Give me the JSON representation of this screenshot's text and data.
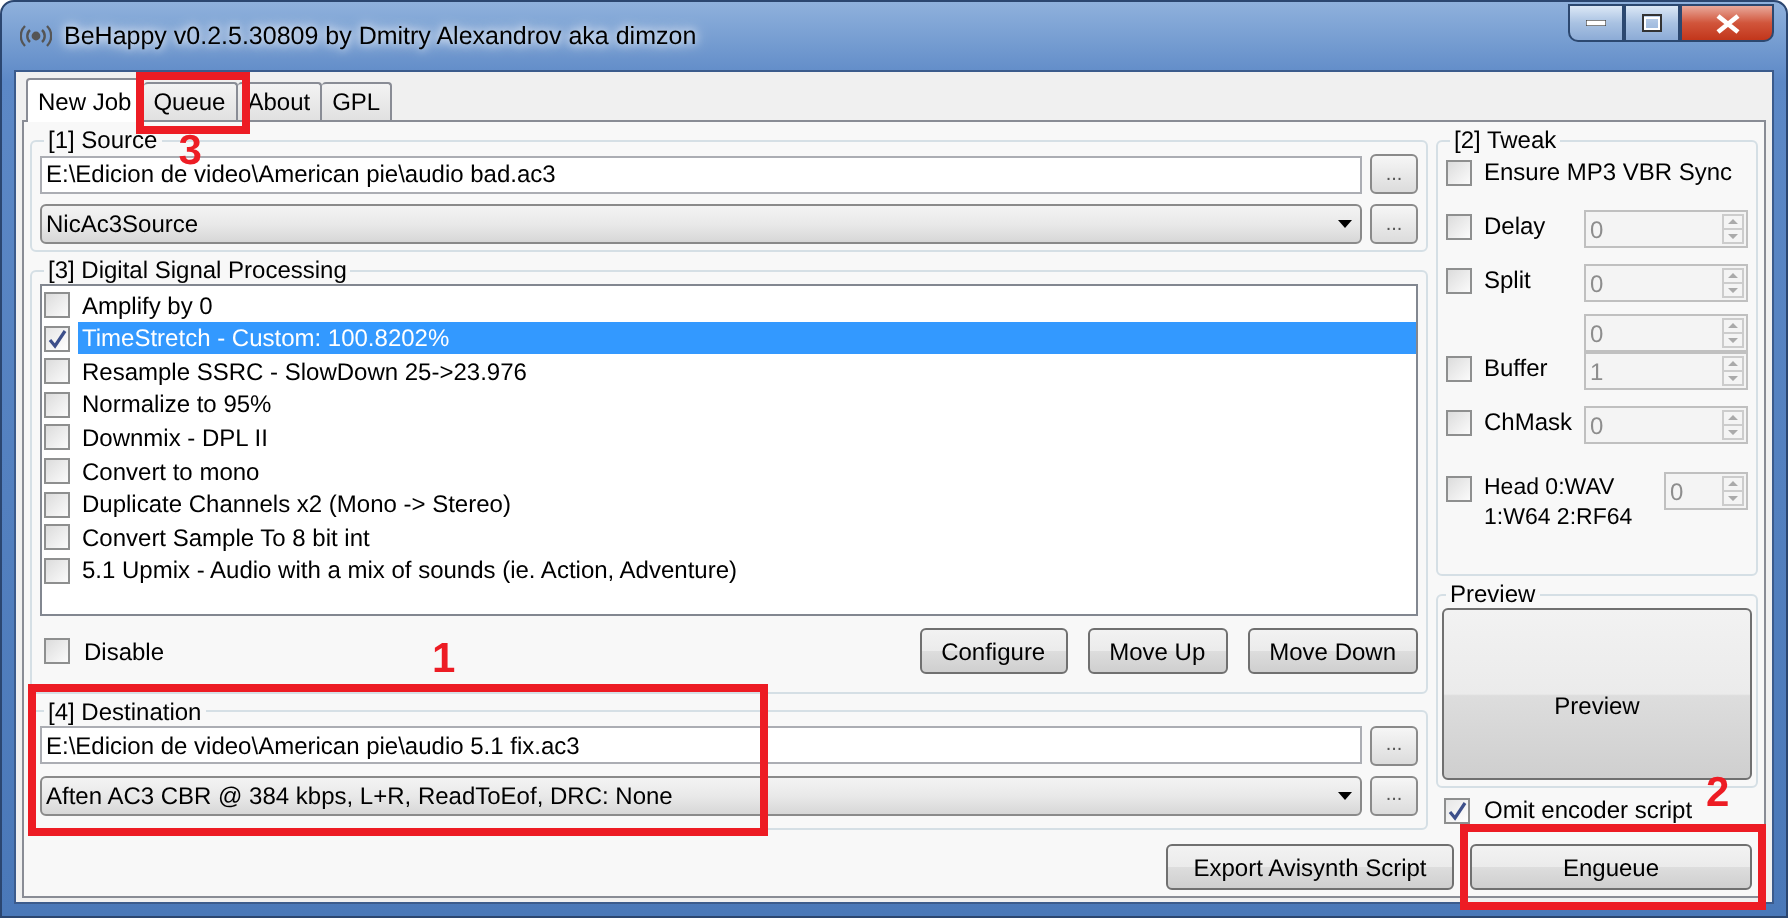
{
  "window": {
    "title": "BeHappy v0.2.5.30809 by Dmitry Alexandrov aka dimzon"
  },
  "tabs": [
    {
      "label": "New Job",
      "selected": true
    },
    {
      "label": "Queue",
      "selected": false,
      "annotation": "3"
    },
    {
      "label": "About",
      "selected": false
    },
    {
      "label": "GPL",
      "selected": false
    }
  ],
  "source": {
    "legend": "[1] Source",
    "path": "E:\\Edicion de video\\American pie\\audio bad.ac3",
    "browse": "...",
    "decoder": "NicAc3Source",
    "decoder_button": "..."
  },
  "dsp": {
    "legend": "[3] Digital Signal Processing",
    "items": [
      {
        "label": "Amplify by 0",
        "checked": false,
        "selected": false
      },
      {
        "label": "TimeStretch - Custom: 100.8202%",
        "checked": true,
        "selected": true
      },
      {
        "label": "Resample SSRC - SlowDown 25->23.976",
        "checked": false,
        "selected": false
      },
      {
        "label": "Normalize to 95%",
        "checked": false,
        "selected": false
      },
      {
        "label": "Downmix - DPL II",
        "checked": false,
        "selected": false
      },
      {
        "label": "Convert to mono",
        "checked": false,
        "selected": false
      },
      {
        "label": "Duplicate Channels x2 (Mono -> Stereo)",
        "checked": false,
        "selected": false
      },
      {
        "label": "Convert Sample To 8 bit int",
        "checked": false,
        "selected": false
      },
      {
        "label": "5.1 Upmix - Audio with a mix of sounds (ie. Action, Adventure)",
        "checked": false,
        "selected": false
      }
    ],
    "disable": {
      "label": "Disable",
      "checked": false
    },
    "buttons": [
      "Configure",
      "Move Up",
      "Move Down"
    ]
  },
  "destination": {
    "legend": "[4] Destination",
    "annotation": "1",
    "path": "E:\\Edicion de video\\American pie\\audio 5.1 fix.ac3",
    "browse": "...",
    "encoder": "Aften AC3 CBR @ 384 kbps, L+R, ReadToEof, DRC: None",
    "encoder_button": "..."
  },
  "export_button": "Export Avisynth Script",
  "tweak": {
    "legend": "[2] Tweak",
    "rows": [
      {
        "label": "Ensure MP3 VBR Sync",
        "checked": false
      },
      {
        "label": "Delay",
        "checked": false,
        "spins": [
          {
            "value": "0",
            "disabled": true
          }
        ]
      },
      {
        "label": "Split",
        "checked": false,
        "spins": [
          {
            "value": "0",
            "disabled": true
          },
          {
            "value": "0",
            "disabled": true
          }
        ]
      },
      {
        "label": "Buffer",
        "checked": false,
        "spins": [
          {
            "value": "1",
            "disabled": true
          }
        ]
      },
      {
        "label": "ChMask",
        "checked": false,
        "spins": [
          {
            "value": "0",
            "disabled": true
          }
        ]
      },
      {
        "label": "Head 0:WAV 1:W64 2:RF64",
        "checked": false,
        "spins": [
          {
            "value": "0",
            "disabled": true
          }
        ]
      }
    ]
  },
  "preview": {
    "legend": "Preview",
    "button": "Preview"
  },
  "omit_encoder_script": {
    "label": "Omit encoder script",
    "checked": true
  },
  "enqueue": {
    "label": "Engueue",
    "annotation": "2"
  }
}
